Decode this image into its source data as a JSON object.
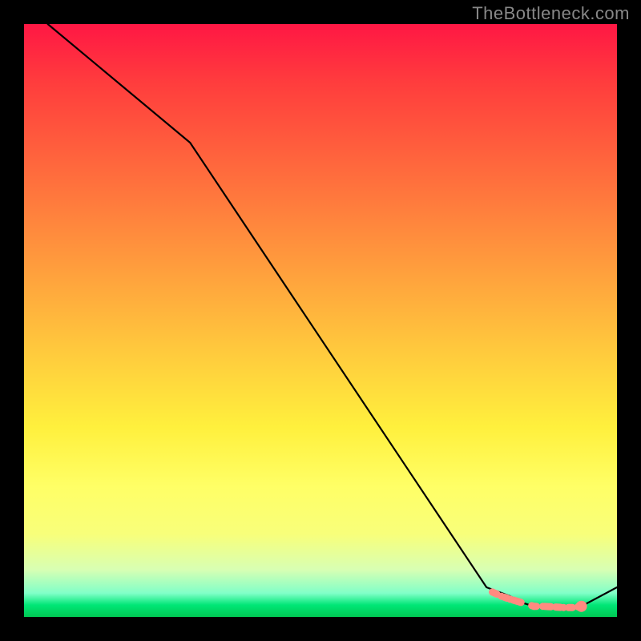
{
  "watermark": "TheBottleneck.com",
  "chart_data": {
    "type": "line",
    "title": "",
    "xlabel": "",
    "ylabel": "",
    "xlim": [
      0,
      100
    ],
    "ylim": [
      0,
      100
    ],
    "background_gradient": {
      "top": "#ff1744",
      "mid": "#fff03d",
      "bottom": "#00c853"
    },
    "series": [
      {
        "name": "curve",
        "color": "#000000",
        "x": [
          4,
          28,
          78,
          82,
          84,
          86,
          88,
          90,
          92,
          94,
          100
        ],
        "values": [
          100,
          80,
          5,
          3.5,
          2.4,
          1.8,
          1.6,
          1.6,
          1.6,
          1.8,
          5
        ]
      }
    ],
    "markers": {
      "name": "points",
      "color": "#ff8a80",
      "x": [
        79,
        80.5,
        82,
        86,
        87.5,
        91,
        92.5,
        94
      ],
      "values": [
        4.2,
        3.5,
        3.0,
        1.8,
        1.8,
        1.6,
        1.6,
        1.8
      ],
      "style": [
        "dot",
        "dot",
        "dot",
        "dot",
        "dot",
        "dot",
        "dot",
        "big"
      ]
    }
  }
}
